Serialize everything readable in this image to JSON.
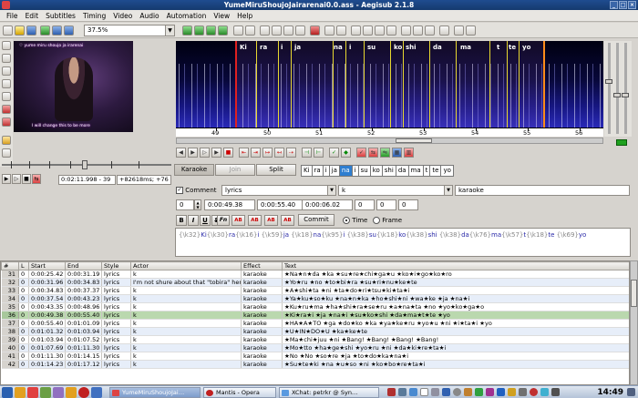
{
  "window": {
    "title": "YumeMiruShoujoJairarenai0.0.ass - Aegisub 2.1.8"
  },
  "menu": [
    "File",
    "Edit",
    "Subtitles",
    "Timing",
    "Video",
    "Audio",
    "Automation",
    "View",
    "Help"
  ],
  "toolbar": {
    "zoom": "37.5%"
  },
  "video": {
    "sub_top": "♡ yume miru shoujo ja irarenai",
    "sub_bottom": "I will change this to be more",
    "time": "0:02:11.998 - 39",
    "frame": "+82618ms; +76"
  },
  "audio": {
    "syllables": [
      "Ki",
      "ra",
      "i",
      "ja",
      "na",
      "i",
      "su",
      "ko",
      "shi",
      "da",
      "ma",
      "t",
      "te",
      "yo"
    ],
    "ruler": [
      "49",
      "50",
      "51",
      "52",
      "53",
      "54",
      "55",
      "56"
    ]
  },
  "karaoke": {
    "karaoke_label": "Karaoke",
    "join_label": "Join",
    "split_label": "Split",
    "syllables": [
      "Ki",
      "ra",
      "i",
      "ja",
      "na",
      "i",
      "su",
      "ko",
      "shi",
      "da",
      "ma",
      "t",
      "te",
      "yo"
    ],
    "active_index": 4
  },
  "edit": {
    "comment_label": "Comment",
    "style": "lyrics",
    "actor": "k",
    "effect": "karaoke",
    "layer": "0",
    "start": "0:00:49.38",
    "end": "0:00:55.40",
    "duration": "0:00:06.02",
    "margin_l": "0",
    "margin_r": "0",
    "margin_v": "0",
    "commit_label": "Commit",
    "time_label": "Time",
    "frame_label": "Frame",
    "fmt_buttons": [
      "B",
      "I",
      "U",
      "S",
      "Fn",
      "AB",
      "AB",
      "AB",
      "AB"
    ],
    "text_parts": [
      {
        "tag": "{\\k32}",
        "syl": "Ki"
      },
      {
        "tag": "{\\k30}",
        "syl": "ra"
      },
      {
        "tag": "{\\k16}",
        "syl": "i "
      },
      {
        "tag": "{\\k59}",
        "syl": "ja "
      },
      {
        "tag": "{\\k18}",
        "syl": "na"
      },
      {
        "tag": "{\\k95}",
        "syl": "i "
      },
      {
        "tag": "{\\k38}",
        "syl": "su"
      },
      {
        "tag": "{\\k18}",
        "syl": "ko"
      },
      {
        "tag": "{\\k38}",
        "syl": "shi "
      },
      {
        "tag": "{\\k38}",
        "syl": "da"
      },
      {
        "tag": "{\\k76}",
        "syl": "ma"
      },
      {
        "tag": "{\\k57}",
        "syl": "t"
      },
      {
        "tag": "{\\k18}",
        "syl": "te "
      },
      {
        "tag": "{\\k69}",
        "syl": "yo"
      }
    ]
  },
  "grid": {
    "columns": [
      "#",
      "L",
      "Start",
      "End",
      "Style",
      "Actor",
      "Effect",
      "Text"
    ],
    "rows": [
      [
        "31",
        "0",
        "0:00:25.42",
        "0:00:31.19",
        "lyrics",
        "k",
        "karaoke",
        "★Na★n★da ★ka ★su★re★chi★ga★u ★ko★i★go★ko★ro"
      ],
      [
        "32",
        "0",
        "0:00:31.96",
        "0:00:34.83",
        "lyrics",
        "I'm not shure about that \"tobira\" here",
        "karaoke",
        "★Yo★ru ★no ★to★bi★ra ★su★ri★nu★ke★te"
      ],
      [
        "33",
        "0",
        "0:00:34.83",
        "0:00:37.37",
        "lyrics",
        "k",
        "karaoke",
        "★A★shi★ta ★ni ★ta★do★ri★tsu★ki★ta★i"
      ],
      [
        "34",
        "0",
        "0:00:37.54",
        "0:00:43.23",
        "lyrics",
        "k",
        "karaoke",
        "★Ya★ku★so★ku ★na★n★ka ★ho★shi★ni ★wa★ke ★ja ★na★i"
      ],
      [
        "35",
        "0",
        "0:00:43.35",
        "0:00:48.96",
        "lyrics",
        "k",
        "karaoke",
        "★Ku★ru★ma ★ha★shi★ra★se★ru ★a★na★ta ★no ★yo★ko★ga★o"
      ],
      [
        "36",
        "0",
        "0:00:49.38",
        "0:00:55.40",
        "lyrics",
        "k",
        "karaoke",
        "★Ki★ra★i ★ja ★na★i ★su★ko★shi ★da★ma★t★te ★yo"
      ],
      [
        "37",
        "0",
        "0:00:55.40",
        "0:01:01.09",
        "lyrics",
        "k",
        "karaoke",
        "★HA★A★TO ★ga ★do★ko ★ka ★ya★ke★ru ★yo★u ★ni ★i★ta★i ★yo"
      ],
      [
        "38",
        "0",
        "0:01:01.32",
        "0:01:03.94",
        "lyrics",
        "k",
        "karaoke",
        "★U★IN★DO★U ★ka★ke★te"
      ],
      [
        "39",
        "0",
        "0:01:03.94",
        "0:01:07.52",
        "lyrics",
        "k",
        "karaoke",
        "★Ma★chi★juu ★ni ★Bang! ★Bang! ★Bang! ★Bang!"
      ],
      [
        "40",
        "0",
        "0:01:07.69",
        "0:01:11.30",
        "lyrics",
        "k",
        "karaoke",
        "★Mo★tto ★ha★ge★shi ★yo★ru ★ni ★da★ki★re★ta★i"
      ],
      [
        "41",
        "0",
        "0:01:11.30",
        "0:01:14.15",
        "lyrics",
        "k",
        "karaoke",
        "★No ★No ★so★re ★ja ★to★do★ka★na★i"
      ],
      [
        "42",
        "0",
        "0:01:14.23",
        "0:01:17.12",
        "lyrics",
        "k",
        "karaoke",
        "★Su★te★ki ★na ★u★so ★ni ★ko★bo★re★ta★i"
      ]
    ],
    "selected_index": 5
  },
  "taskbar": {
    "tasks": [
      "YumeMiruShoujoJai…",
      "Mantis - Opera",
      "XChat: petrkr @ Syn…"
    ],
    "clock": "14:49"
  }
}
